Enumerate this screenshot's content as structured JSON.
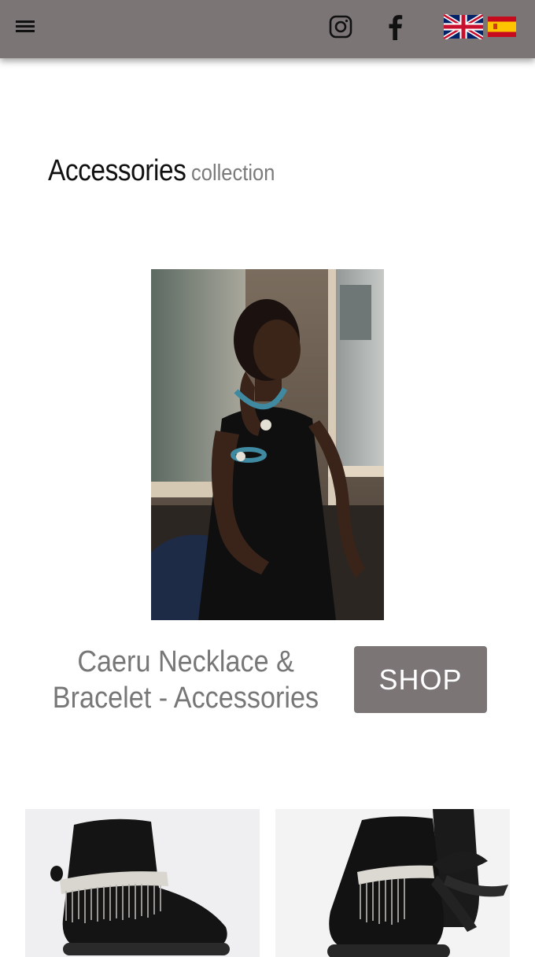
{
  "header": {
    "menu_icon": "hamburger-menu-icon",
    "instagram_icon": "instagram-icon",
    "facebook_icon": "facebook-icon",
    "languages": [
      "English",
      "Español"
    ]
  },
  "section": {
    "title_main": "Accessories",
    "title_sub": "collection"
  },
  "feature": {
    "product_line1": "Caeru Necklace &",
    "product_line2": "Bracelet - Accessories",
    "shop_label": "SHOP"
  },
  "colors": {
    "header_bg": "#7b7576",
    "shop_button_bg": "#7b7576",
    "product_text": "#777777"
  }
}
